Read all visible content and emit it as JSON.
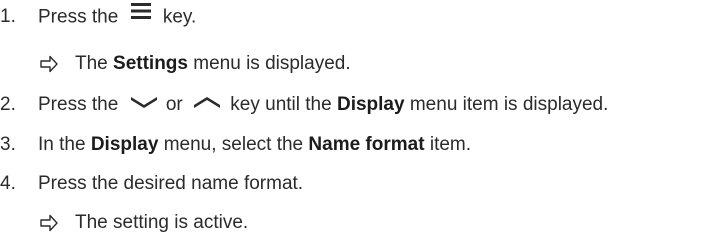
{
  "steps": [
    {
      "number": "1.",
      "before": "Press the",
      "icon": "menu-icon",
      "after": "key."
    },
    {
      "result_arrow": "⇨",
      "pre": "The",
      "bold": "Settings",
      "post": "menu is displayed."
    },
    {
      "number": "2.",
      "before": "Press the",
      "icon1": "chevron-down-icon",
      "mid": "or",
      "icon2": "chevron-up-icon",
      "after_pre": "key until the",
      "bold": "Display",
      "after_post": "menu item is displayed."
    },
    {
      "number": "3.",
      "pre": "In the",
      "bold1": "Display",
      "mid": "menu, select the",
      "bold2": "Name format",
      "post": "item."
    },
    {
      "number": "4.",
      "text": "Press the desired name format."
    },
    {
      "result_arrow": "⇨",
      "text": "The setting is active."
    }
  ],
  "colors": {
    "text": "#2b2b2b",
    "icon": "#2b2b2b"
  }
}
